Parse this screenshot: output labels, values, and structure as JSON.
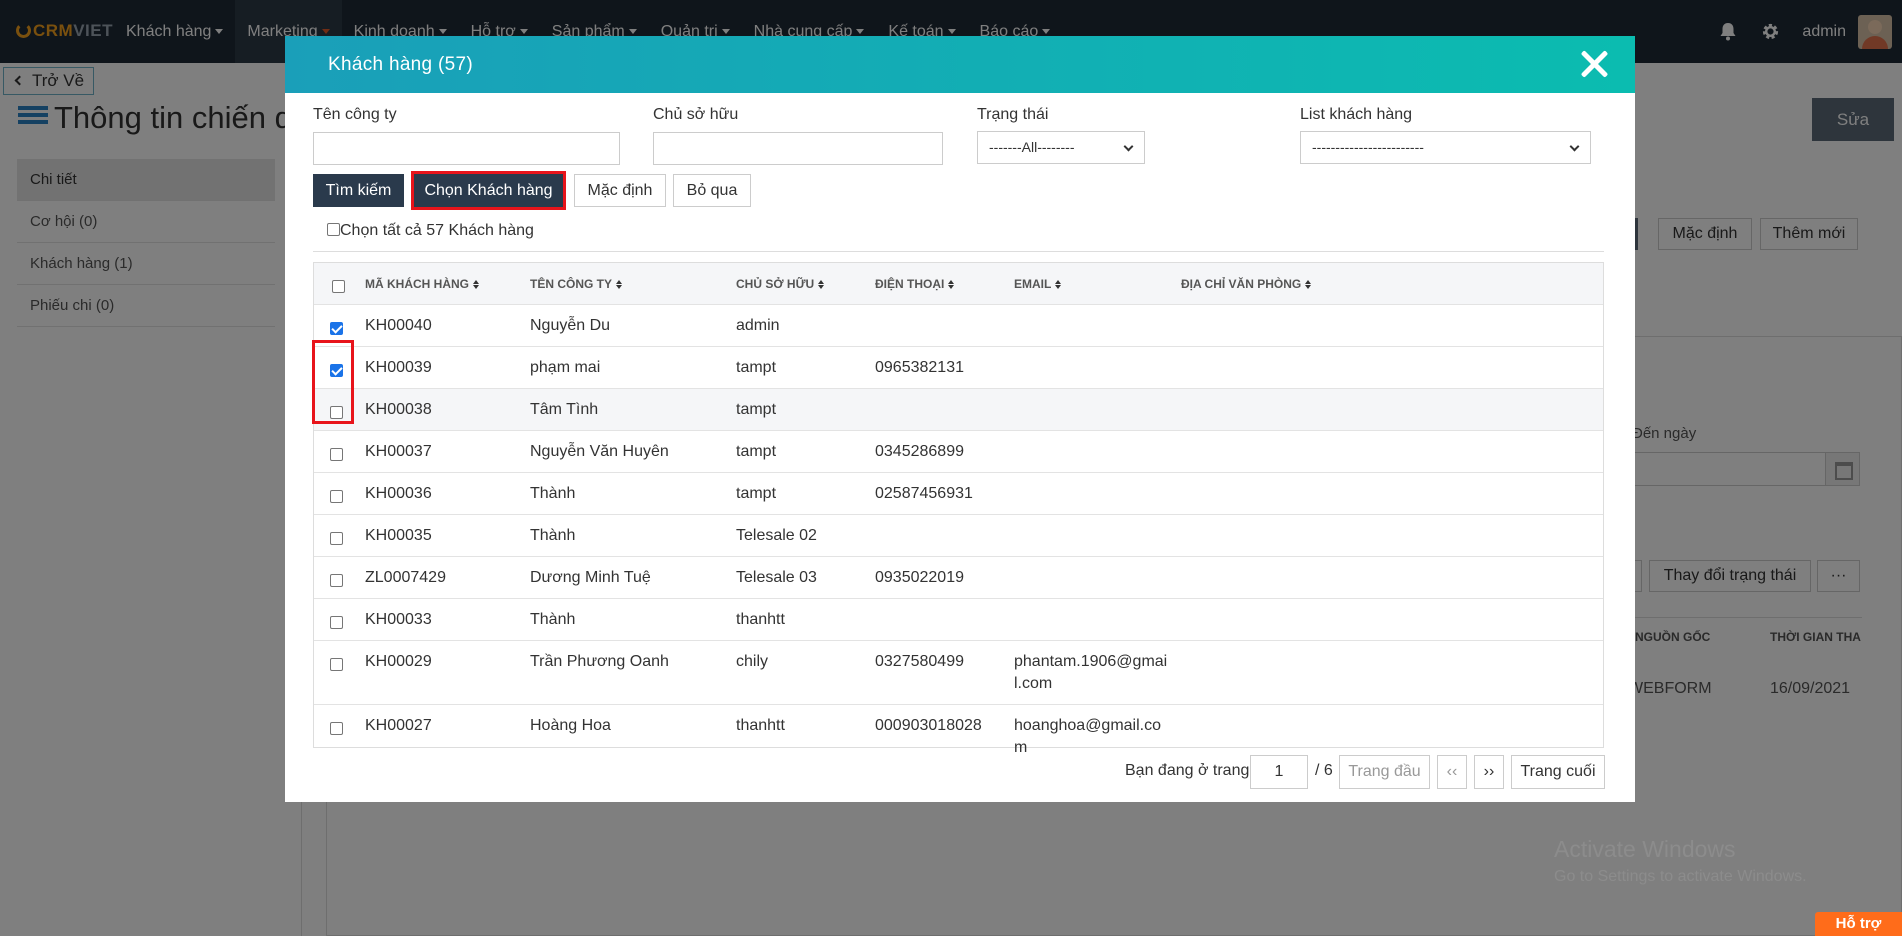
{
  "navbar": {
    "logo_crm": "CRM",
    "logo_viet": "VIET",
    "menu": [
      {
        "label": "Khách hàng"
      },
      {
        "label": "Marketing"
      },
      {
        "label": "Kinh doanh"
      },
      {
        "label": "Hỗ trợ"
      },
      {
        "label": "Sản phẩm"
      },
      {
        "label": "Quản trị"
      },
      {
        "label": "Nhà cung cấp"
      },
      {
        "label": "Kế toán"
      },
      {
        "label": "Báo cáo"
      }
    ],
    "user": "admin"
  },
  "page": {
    "back_label": "Trở Về",
    "title": "Thông tin chiến d",
    "edit_label": "Sửa",
    "sidebar": [
      {
        "label": "Chi tiết"
      },
      {
        "label": "Cơ hội (0)"
      },
      {
        "label": "Khách hàng (1)"
      },
      {
        "label": "Phiếu chi (0)"
      }
    ],
    "bg_buttons": {
      "default": "Mặc định",
      "add_new": "Thêm mới",
      "change_status": "Thay đổi trạng thái",
      "more": "···"
    },
    "bg_to_date_label": "Đến ngày",
    "bg_columns": {
      "source": "NGUỒN GỐC",
      "time": "THỜI GIAN THA"
    },
    "bg_row": {
      "source": "WEBFORM",
      "time": "16/09/2021"
    }
  },
  "modal": {
    "title": "Khách hàng (57)",
    "filters": {
      "company_label": "Tên công ty",
      "company_value": "",
      "owner_label": "Chủ sở hữu",
      "owner_value": "",
      "status_label": "Trạng thái",
      "status_value": "-------All--------",
      "list_label": "List khách hàng",
      "list_value": "------------------------"
    },
    "buttons": {
      "search": "Tìm kiếm",
      "choose": "Chọn Khách hàng",
      "default": "Mặc định",
      "skip": "Bỏ qua"
    },
    "select_all_label": "Chọn tất cả 57 Khách hàng",
    "columns": {
      "code": "MÃ KHÁCH HÀNG",
      "company": "TÊN CÔNG TY",
      "owner": "CHỦ SỞ HỮU",
      "phone": "ĐIỆN THOẠI",
      "email": "EMAIL",
      "address": "ĐỊA CHỈ VĂN PHÒNG"
    },
    "rows": [
      {
        "checked": true,
        "code": "KH00040",
        "company": "Nguyễn Du",
        "owner": "admin",
        "phone": "",
        "email": "",
        "address": ""
      },
      {
        "checked": true,
        "code": "KH00039",
        "company": "phạm mai",
        "owner": "tampt",
        "phone": "0965382131",
        "email": "",
        "address": ""
      },
      {
        "checked": false,
        "code": "KH00038",
        "company": "Tâm Tình",
        "owner": "tampt",
        "phone": "",
        "email": "",
        "address": ""
      },
      {
        "checked": false,
        "code": "KH00037",
        "company": "Nguyễn Văn Huyên",
        "owner": "tampt",
        "phone": "0345286899",
        "email": "",
        "address": ""
      },
      {
        "checked": false,
        "code": "KH00036",
        "company": "Thành",
        "owner": "tampt",
        "phone": "02587456931",
        "email": "",
        "address": ""
      },
      {
        "checked": false,
        "code": "KH00035",
        "company": "Thành",
        "owner": "Telesale 02",
        "phone": "",
        "email": "",
        "address": ""
      },
      {
        "checked": false,
        "code": "ZL0007429",
        "company": "Dương Minh Tuệ",
        "owner": "Telesale 03",
        "phone": "0935022019",
        "email": "",
        "address": ""
      },
      {
        "checked": false,
        "code": "KH00033",
        "company": "Thành",
        "owner": "thanhtt",
        "phone": "",
        "email": "",
        "address": ""
      },
      {
        "checked": false,
        "code": "KH00029",
        "company": "Trần Phương Oanh",
        "owner": "chily",
        "phone": "0327580499",
        "email": "phantam.1906@gmail.com",
        "address": ""
      },
      {
        "checked": false,
        "code": "KH00027",
        "company": "Hoàng Hoa",
        "owner": "thanhtt",
        "phone": "000903018028",
        "email": "hoanghoa@gmail.com",
        "address": ""
      }
    ],
    "pagination": {
      "prefix": "Bạn đang ở trang",
      "current": "1",
      "total": "/ 6",
      "first": "Trang đầu",
      "prev": "‹‹",
      "next": "››",
      "last": "Trang cuối"
    }
  },
  "watermark": {
    "line1": "Activate Windows",
    "line2": "Go to Settings to activate Windows."
  },
  "support_label": "Hỗ trợ"
}
